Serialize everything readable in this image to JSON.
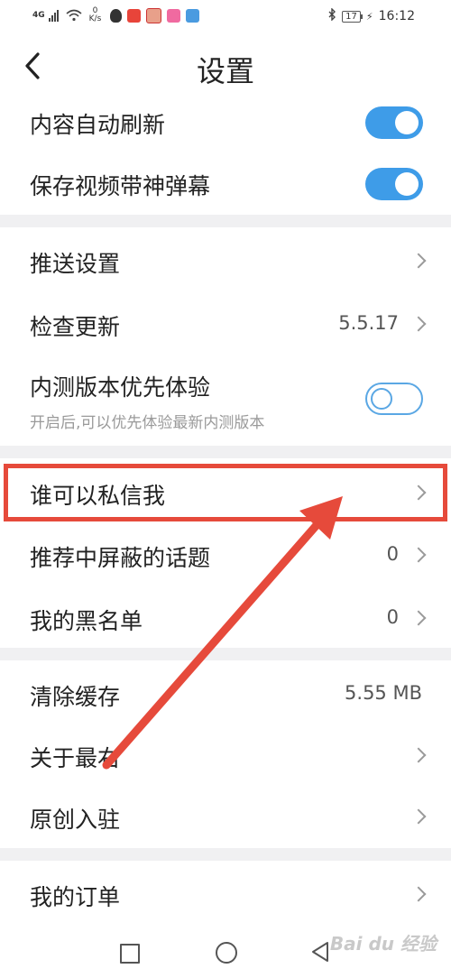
{
  "status_bar": {
    "network": "4G",
    "speed_value": "0",
    "speed_unit": "K/s",
    "battery": "17",
    "time": "16:12"
  },
  "header": {
    "back_glyph": "‹",
    "title": "设置"
  },
  "sections": [
    {
      "items": [
        {
          "label": "内容自动刷新",
          "control": "toggle",
          "state": "on"
        },
        {
          "label": "保存视频带神弹幕",
          "control": "toggle",
          "state": "on"
        }
      ]
    },
    {
      "items": [
        {
          "label": "推送设置",
          "control": "chevron"
        },
        {
          "label": "检查更新",
          "value": "5.5.17",
          "control": "chevron"
        },
        {
          "label": "内测版本优先体验",
          "sublabel": "开启后,可以优先体验最新内测版本",
          "control": "toggle",
          "state": "off"
        }
      ]
    },
    {
      "items": [
        {
          "label": "谁可以私信我",
          "control": "chevron",
          "highlighted": true
        },
        {
          "label": "推荐中屏蔽的话题",
          "value": "0",
          "control": "chevron"
        },
        {
          "label": "我的黑名单",
          "value": "0",
          "control": "chevron"
        }
      ]
    },
    {
      "items": [
        {
          "label": "清除缓存",
          "value": "5.55 MB",
          "control": "none"
        },
        {
          "label": "关于最右",
          "control": "chevron"
        },
        {
          "label": "原创入驻",
          "control": "chevron"
        }
      ]
    },
    {
      "items": [
        {
          "label": "我的订单",
          "control": "chevron"
        }
      ]
    }
  ],
  "colors": {
    "toggle_on": "#3e9ce8",
    "highlight": "#e64a3b",
    "section_gap": "#f0f0f2"
  },
  "icons": {
    "back": "chevron-left-icon",
    "row_arrow": "chevron-right-icon",
    "nav": [
      "recent-apps-icon",
      "home-icon",
      "back-triangle-icon"
    ]
  },
  "watermark": "Bai du 经验"
}
